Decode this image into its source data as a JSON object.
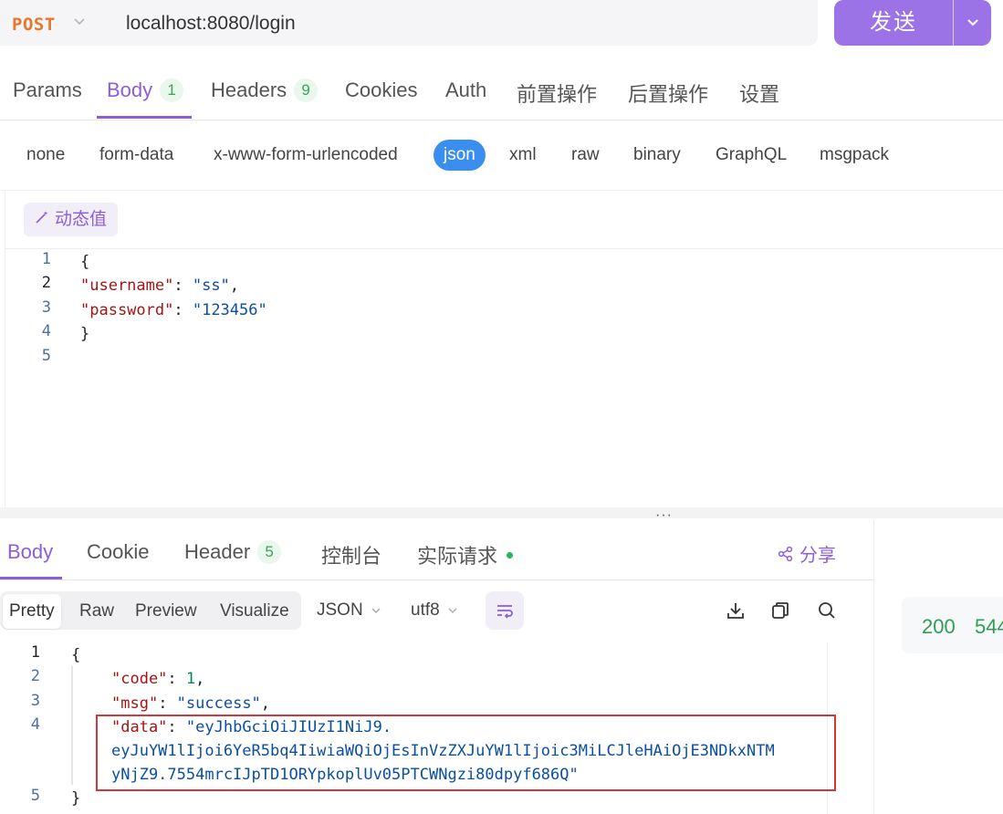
{
  "request": {
    "method": "POST",
    "url": "localhost:8080/login",
    "send_label": "发送"
  },
  "request_tabs": [
    {
      "label": "Params"
    },
    {
      "label": "Body",
      "badge": "1",
      "active": true
    },
    {
      "label": "Headers",
      "badge": "9"
    },
    {
      "label": "Cookies"
    },
    {
      "label": "Auth"
    },
    {
      "label": "前置操作"
    },
    {
      "label": "后置操作"
    },
    {
      "label": "设置"
    }
  ],
  "body_types": [
    "none",
    "form-data",
    "x-www-form-urlencoded",
    "json",
    "xml",
    "raw",
    "binary",
    "GraphQL",
    "msgpack"
  ],
  "body_type_selected": "json",
  "dynamic_value_label": "动态值",
  "request_body": {
    "line_numbers": [
      "1",
      "2",
      "3",
      "4",
      "5"
    ],
    "open_brace": "{",
    "close_brace": "}",
    "username_key": "\"username\"",
    "username_value": "\"ss\"",
    "password_key": "\"password\"",
    "password_value": "\"123456\""
  },
  "response_tabs": [
    {
      "label": "Body",
      "active": true
    },
    {
      "label": "Cookie"
    },
    {
      "label": "Header",
      "badge": "5"
    },
    {
      "label": "控制台"
    },
    {
      "label": "实际请求",
      "dot": true
    }
  ],
  "share_label": "分享",
  "view_modes": [
    "Pretty",
    "Raw",
    "Preview",
    "Visualize"
  ],
  "view_mode_selected": "Pretty",
  "format_select": "JSON",
  "encoding_select": "utf8",
  "status": {
    "code": "200",
    "size": "544"
  },
  "response_body": {
    "line_numbers": [
      "1",
      "2",
      "3",
      "4",
      "5"
    ],
    "open_brace": "{",
    "close_brace": "}",
    "code_key": "\"code\"",
    "code_value": "1",
    "msg_key": "\"msg\"",
    "msg_value": "\"success\"",
    "data_key": "\"data\"",
    "data_value_line1": "\"eyJhbGciOiJIUzI1NiJ9.",
    "data_value_line2": "eyJuYW1lIjoi6YeR5bq4IiwiaWQiOjEsInVzZXJuYW1lIjoic3MiLCJleHAiOjE3NDkxNTM",
    "data_value_line3": "yNjZ9.7554mrcIJpTD1ORYpkoplUv05PTCWNgzi80dpyf686Q\""
  },
  "colors": {
    "accent": "#8b5fd6",
    "send_button": "#9b73e6",
    "method": "#e8772e",
    "status_ok": "#2f9e55",
    "highlight_box": "#d63638",
    "json_selected": "#3a8ef0"
  },
  "icons": [
    "chevron-down-icon",
    "magic-wand-icon",
    "share-icon",
    "download-icon",
    "copy-icon",
    "search-icon",
    "wrap-lines-icon"
  ]
}
